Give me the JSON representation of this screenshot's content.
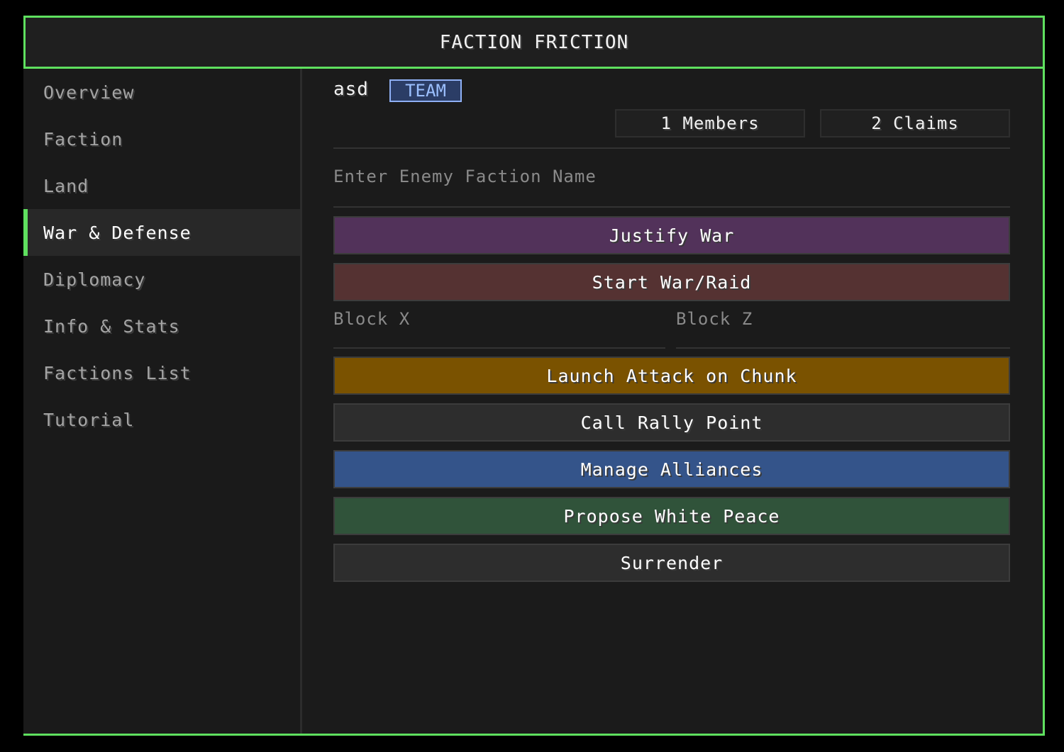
{
  "window": {
    "title": "FACTION FRICTION"
  },
  "sidebar": {
    "items": [
      {
        "label": "Overview",
        "active": false
      },
      {
        "label": "Faction",
        "active": false
      },
      {
        "label": "Land",
        "active": false
      },
      {
        "label": "War & Defense",
        "active": true
      },
      {
        "label": "Diplomacy",
        "active": false
      },
      {
        "label": "Info & Stats",
        "active": false
      },
      {
        "label": "Factions List",
        "active": false
      },
      {
        "label": "Tutorial",
        "active": false
      }
    ]
  },
  "main": {
    "faction_name": "asd",
    "team_tag": "TEAM",
    "stats": {
      "members": "1 Members",
      "claims": "2 Claims"
    },
    "enemy_input": {
      "value": "",
      "placeholder": "Enter Enemy Faction Name"
    },
    "block_x": {
      "value": "",
      "placeholder": "Block X"
    },
    "block_z": {
      "value": "",
      "placeholder": "Block Z"
    },
    "buttons": {
      "justify_war": "Justify War",
      "start_war": "Start War/Raid",
      "launch_attack": "Launch Attack on Chunk",
      "rally_point": "Call Rally Point",
      "manage_alliances": "Manage Alliances",
      "white_peace": "Propose White Peace",
      "surrender": "Surrender"
    }
  },
  "colors": {
    "accent": "#5fe05f",
    "justify_war": "#52325a",
    "start_war": "#553232",
    "launch_attack": "#7a5200",
    "neutral": "#2d2d2d",
    "manage_alliances": "#34548a",
    "white_peace": "#30533a",
    "team_tag": "#8fb0f5"
  }
}
